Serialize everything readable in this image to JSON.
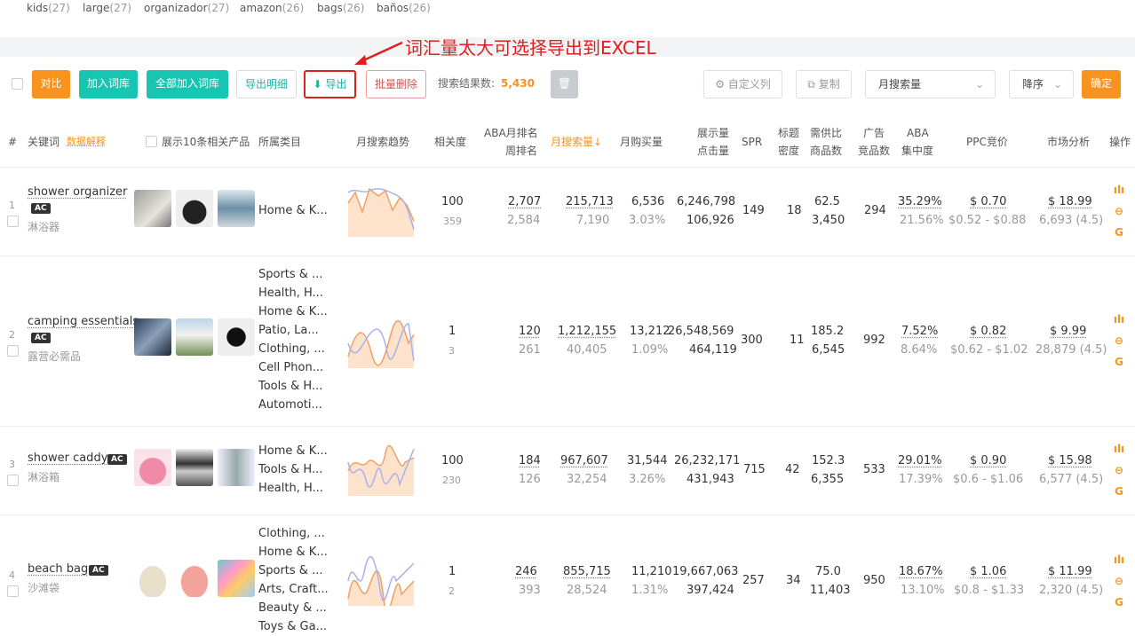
{
  "tags": [
    {
      "word": "kids",
      "count": "(27)"
    },
    {
      "word": "large",
      "count": "(27)"
    },
    {
      "word": "organizador",
      "count": "(27)"
    },
    {
      "word": "amazon",
      "count": "(26)"
    },
    {
      "word": "bags",
      "count": "(26)"
    },
    {
      "word": "baños",
      "count": "(26)"
    }
  ],
  "annotation": "词汇量太大可选择导出到EXCEL",
  "toolbar": {
    "compare": "对比",
    "add_lib": "加入词库",
    "add_all": "全部加入词库",
    "export_detail": "导出明细",
    "export": "导出",
    "batch_delete": "批量删除",
    "result_label": "搜索结果数:",
    "result_count": "5,430",
    "custom_cols": "自定义列",
    "copy": "复制",
    "sort_field": "月搜索量",
    "sort_order": "降序",
    "confirm": "确定"
  },
  "header": {
    "idx": "#",
    "keyword": "关键词",
    "explain": "数据解释",
    "show10": "展示10条相关产品",
    "category": "所属类目",
    "trend": "月搜索趋势",
    "relevance": "相关度",
    "aba_month": "ABA月排名",
    "aba_week": "周排名",
    "monthly_search": "月搜索量↓",
    "monthly_buy": "月购买量",
    "impressions": "展示量",
    "clicks": "点击量",
    "spr": "SPR",
    "title_a": "标题",
    "title_b": "密度",
    "supply_a": "需供比",
    "supply_b": "商品数",
    "ad_a": "广告",
    "ad_b": "竞品数",
    "conc_a": "ABA",
    "conc_b": "集中度",
    "ppc": "PPC竞价",
    "market": "市场分析",
    "ops": "操作"
  },
  "rows": [
    {
      "n": "1",
      "kw": "shower organizer",
      "cn": "淋浴器",
      "cats": [
        "Home & K..."
      ],
      "rel": "100",
      "rel2": "359",
      "aba": "2,707",
      "abaw": "2,584",
      "ms": "215,713",
      "ms2": "7,190",
      "mb": "6,536",
      "mb2": "3.03%",
      "imp": "6,246,798",
      "clk": "106,926",
      "spr": "149",
      "td": "18",
      "sd": "62.5",
      "sd2": "3,450",
      "ad": "294",
      "conc": "35.29%",
      "conc2": "21.56%",
      "ppc": "$ 0.70",
      "ppc2": "$0.52 - $0.88",
      "mkt": "$ 18.99",
      "mkt2": "6,693 (4.5)"
    },
    {
      "n": "2",
      "kw": "camping essentials",
      "cn": "露营必需品",
      "cats": [
        "Sports & ...",
        "Health, H...",
        "Home & K...",
        "Patio, La...",
        "Clothing, ...",
        "Cell Phon...",
        "Tools & H...",
        "Automoti..."
      ],
      "rel": "1",
      "rel2": "3",
      "aba": "120",
      "abaw": "261",
      "ms": "1,212,155",
      "ms2": "40,405",
      "mb": "13,212",
      "mb2": "1.09%",
      "imp": "26,548,569",
      "clk": "464,119",
      "spr": "300",
      "td": "11",
      "sd": "185.2",
      "sd2": "6,545",
      "ad": "992",
      "conc": "7.52%",
      "conc2": "8.64%",
      "ppc": "$ 0.82",
      "ppc2": "$0.62 - $1.02",
      "mkt": "$ 9.99",
      "mkt2": "28,879 (4.5)"
    },
    {
      "n": "3",
      "kw": "shower caddy",
      "cn": "淋浴箱",
      "cats": [
        "Home & K...",
        "Tools & H...",
        "Health, H..."
      ],
      "rel": "100",
      "rel2": "230",
      "aba": "184",
      "abaw": "126",
      "ms": "967,607",
      "ms2": "32,254",
      "mb": "31,544",
      "mb2": "3.26%",
      "imp": "26,232,171",
      "clk": "431,943",
      "spr": "715",
      "td": "42",
      "sd": "152.3",
      "sd2": "6,355",
      "ad": "533",
      "conc": "29.01%",
      "conc2": "17.39%",
      "ppc": "$ 0.90",
      "ppc2": "$0.6 - $1.06",
      "mkt": "$ 15.98",
      "mkt2": "6,577 (4.5)"
    },
    {
      "n": "4",
      "kw": "beach bag",
      "cn": "沙滩袋",
      "cats": [
        "Clothing, ...",
        "Home & K...",
        "Sports & ...",
        "Arts, Craft...",
        "Beauty & ...",
        "Toys & Ga..."
      ],
      "rel": "1",
      "rel2": "2",
      "aba": "246",
      "abaw": "393",
      "ms": "855,715",
      "ms2": "28,524",
      "mb": "11,210",
      "mb2": "1.31%",
      "imp": "19,667,063",
      "clk": "397,424",
      "spr": "257",
      "td": "34",
      "sd": "75.0",
      "sd2": "11,403",
      "ad": "950",
      "conc": "18.67%",
      "conc2": "13.10%",
      "ppc": "$ 1.06",
      "ppc2": "$0.8 - $1.33",
      "mkt": "$ 11.99",
      "mkt2": "2,320 (4.5)"
    }
  ],
  "ac_badge": "AC"
}
